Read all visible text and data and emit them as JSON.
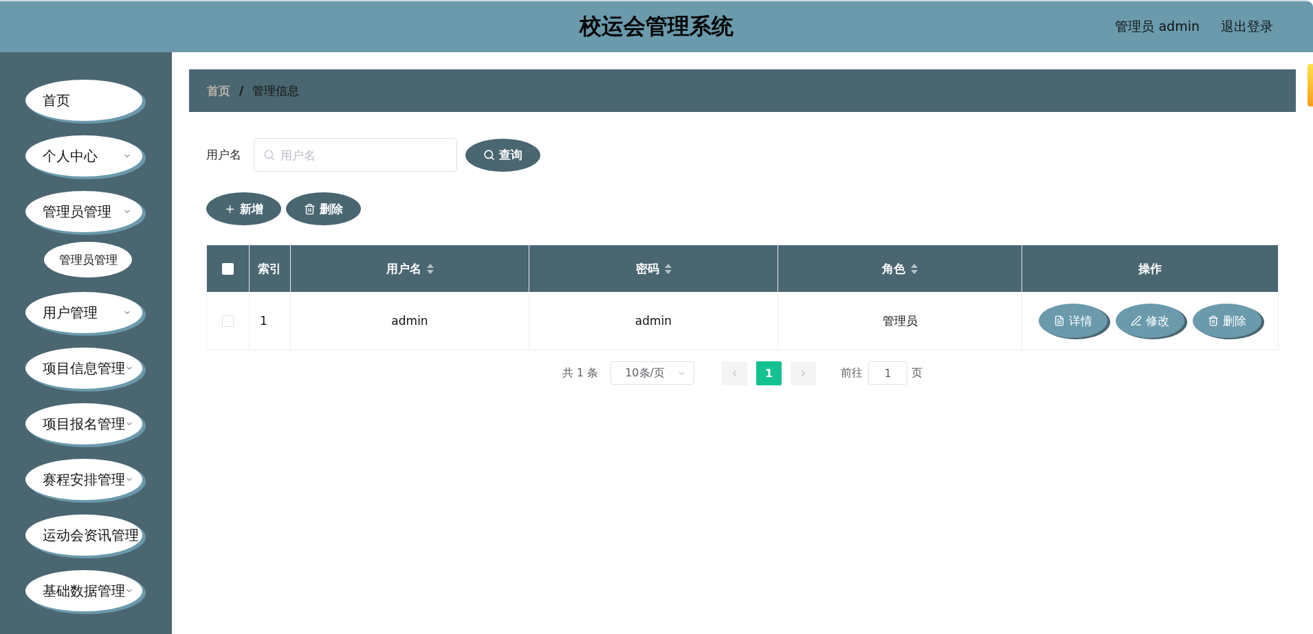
{
  "header": {
    "title": "校运会管理系统",
    "user": "管理员 admin",
    "logout": "退出登录"
  },
  "sidebar": {
    "items": [
      {
        "label": "首页",
        "kind": "link"
      },
      {
        "label": "个人中心",
        "kind": "submenu"
      },
      {
        "label": "管理员管理",
        "kind": "submenu",
        "children": [
          {
            "label": "管理员管理"
          }
        ]
      },
      {
        "label": "用户管理",
        "kind": "submenu"
      },
      {
        "label": "项目信息管理",
        "kind": "submenu"
      },
      {
        "label": "项目报名管理",
        "kind": "submenu"
      },
      {
        "label": "赛程安排管理",
        "kind": "submenu"
      },
      {
        "label": "运动会资讯管理",
        "kind": "link"
      },
      {
        "label": "基础数据管理",
        "kind": "submenu"
      }
    ]
  },
  "breadcrumb": {
    "separator": "/",
    "items": [
      {
        "label": "首页",
        "current": false
      },
      {
        "label": "管理信息",
        "current": true
      }
    ]
  },
  "search": {
    "label": "用户名",
    "placeholder": "用户名",
    "button": "查询"
  },
  "toolbar": [
    {
      "label": "新增",
      "kind": "add"
    },
    {
      "label": "删除",
      "kind": "delete"
    }
  ],
  "table": {
    "select_all": {
      "checked": false
    },
    "columns": [
      {
        "label": "索引",
        "sortable": false
      },
      {
        "label": "用户名",
        "sortable": true
      },
      {
        "label": "密码",
        "sortable": true
      },
      {
        "label": "角色",
        "sortable": true
      },
      {
        "label": "操作",
        "sortable": false
      }
    ],
    "rows": [
      {
        "checked": false,
        "cells": [
          "1",
          "admin",
          "admin",
          "管理员"
        ],
        "actions": [
          {
            "label": "详情",
            "kind": "view"
          },
          {
            "label": "修改",
            "kind": "edit"
          },
          {
            "label": "删除",
            "kind": "delete"
          }
        ]
      }
    ]
  },
  "pagination": {
    "total": "共 1 条",
    "page_size": "10条/页",
    "prev": {
      "disabled": true
    },
    "pages": [
      {
        "label": "1",
        "selected": true
      }
    ],
    "next": {
      "disabled": true
    },
    "goto": {
      "label": "前往",
      "value": "1",
      "suffix": "页"
    }
  }
}
